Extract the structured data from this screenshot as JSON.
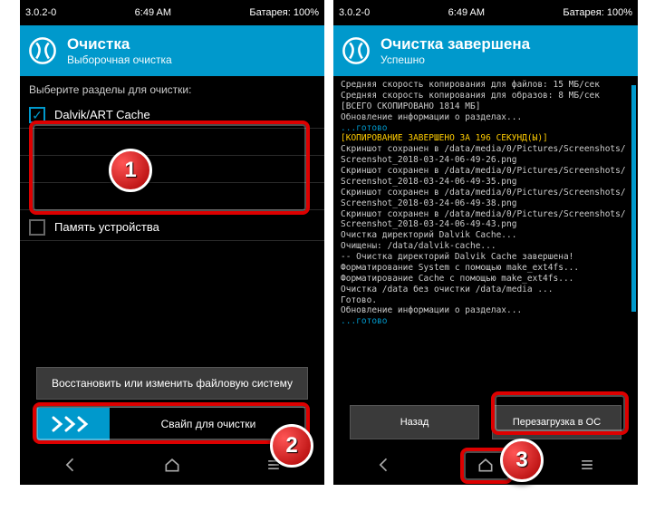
{
  "status": {
    "version": "3.0.2-0",
    "time": "6:49 AM",
    "battery": "Батарея: 100%"
  },
  "left": {
    "title": "Очистка",
    "subtitle": "Выборочная очистка",
    "instruction": "Выберите разделы для очистки:",
    "partitions": {
      "dalvik": "Dalvik/ART Cache",
      "storage": "Память устройства"
    },
    "restore_btn": "Восстановить или изменить файловую систему",
    "swipe_label": "Свайп для очистки"
  },
  "right": {
    "title": "Очистка завершена",
    "subtitle": "Успешно",
    "log": [
      "Средняя скорость копирования для файлов: 15 МБ/сек",
      "Средняя скорость копирования для образов: 8 МБ/сек",
      "[ВСЕГО СКОПИРОВАНО 1814 МБ]",
      "Обновление информации о разделах...",
      "...готово",
      "[КОПИРОВАНИЕ ЗАВЕРШЕНО ЗА 196 СЕКУНД(Ы)]",
      "Скриншот сохранен в /data/media/0/Pictures/Screenshots/",
      "Screenshot_2018-03-24-06-49-26.png",
      "Скриншот сохранен в /data/media/0/Pictures/Screenshots/",
      "Screenshot_2018-03-24-06-49-35.png",
      "Скриншот сохранен в /data/media/0/Pictures/Screenshots/",
      "Screenshot_2018-03-24-06-49-38.png",
      "Скриншот сохранен в /data/media/0/Pictures/Screenshots/",
      "Screenshot_2018-03-24-06-49-43.png",
      "Очистка директорий Dalvik Cache...",
      "Очищены: /data/dalvik-cache...",
      "-- Очистка директорий Dalvik Cache завершена!",
      "Форматирование System с помощью make_ext4fs...",
      "Форматирование Cache с помощью make_ext4fs...",
      "Очистка /data без очистки /data/media ...",
      "Готово.",
      "Обновление информации о разделах...",
      "...готово"
    ],
    "back_btn": "Назад",
    "reboot_btn": "Перезагрузка в ОС"
  },
  "annotations": {
    "n1": "1",
    "n2": "2",
    "n3": "3"
  }
}
